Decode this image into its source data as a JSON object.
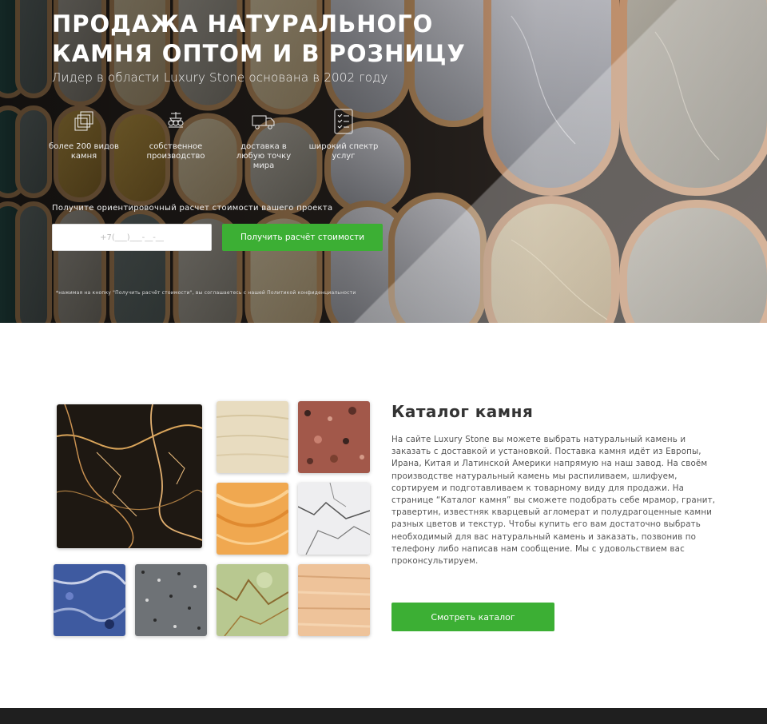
{
  "hero": {
    "title": "ПРОДАЖА НАТУРАЛЬНОГО КАМНЯ ОПТОМ И В РОЗНИЦУ",
    "subtitle": "Лидер в области Luxury Stone основана в 2002 году",
    "features": [
      {
        "icon": "stack-icon",
        "text": "более 200 видов камня"
      },
      {
        "icon": "factory-icon",
        "text": "собственное производство"
      },
      {
        "icon": "truck-icon",
        "text": "доставка в любую точку мира"
      },
      {
        "icon": "checklist-icon",
        "text": "широкий спектр услуг"
      }
    ],
    "cta_label": "Получите ориентировочный расчет стоимости вашего проекта",
    "phone_placeholder": "+7(___)___-__-__",
    "cta_button": "Получить расчёт стоимости",
    "disclaimer": "*нажимая на кнопку \"Получить расчёт стоимости\", вы соглашаетесь с нашей Политикой конфиденциальности"
  },
  "catalog": {
    "title": "Каталог камня",
    "text": "На сайте Luxury Stone вы можете выбрать натуральный камень и заказать с доставкой и установкой. Поставка камня идёт из Европы, Ирана, Китая и Латинской Америки напрямую на наш завод. На своём производстве натуральный камень мы распиливаем, шлифуем, сортируем и подготавливаем к товарному виду для продажи. На странице “Каталог камня” вы сможете подобрать себе мрамор, гранит, травертин, известняк кварцевый агломерат и полудрагоценные камни разных цветов и текстур. Чтобы купить его вам достаточно выбрать необходимый для вас натуральный камень и заказать, позвонив по телефону либо написав нам сообщение. Мы с удовольствием вас проконсультируем.",
    "button": "Смотреть каталог"
  },
  "colors": {
    "accent_green": "#3caf34",
    "footer": "#1f1f1f",
    "title_text": "#333333"
  }
}
